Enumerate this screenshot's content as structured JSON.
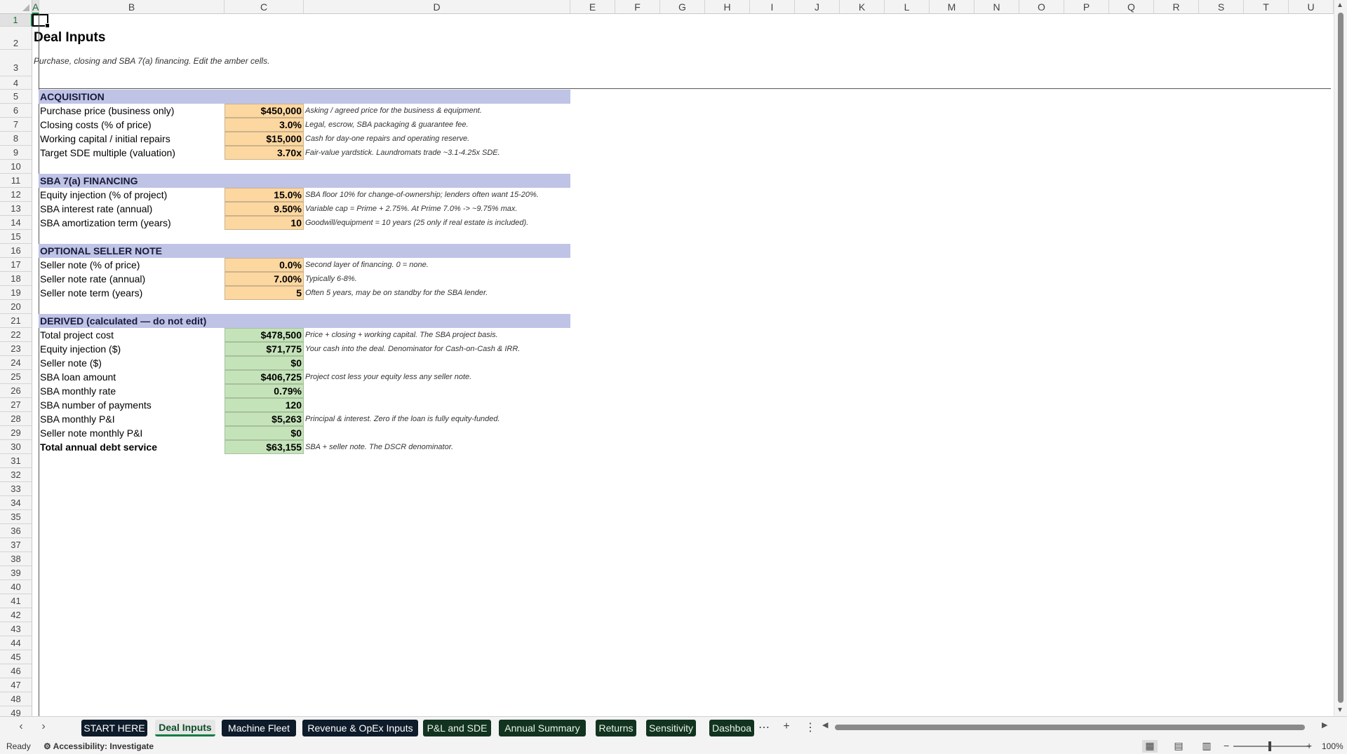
{
  "columns": [
    "A",
    "B",
    "C",
    "D",
    "E",
    "F",
    "G",
    "H",
    "I",
    "J",
    "K",
    "L",
    "M",
    "N",
    "O",
    "P",
    "Q",
    "R",
    "S",
    "T",
    "U"
  ],
  "rows": [
    "1",
    "2",
    "3",
    "4",
    "5",
    "6",
    "7",
    "8",
    "9",
    "10",
    "11",
    "12",
    "13",
    "14",
    "15",
    "16",
    "17",
    "18",
    "19",
    "20",
    "21",
    "22",
    "23",
    "24",
    "25",
    "26",
    "27",
    "28",
    "29",
    "30",
    "31",
    "32",
    "33",
    "34",
    "35",
    "36",
    "37",
    "38",
    "39",
    "40",
    "41",
    "42",
    "43",
    "44",
    "45",
    "46",
    "47",
    "48",
    "49"
  ],
  "sheet": {
    "title": "Deal Inputs",
    "subtitle": "Purchase, closing and SBA 7(a) financing. Edit the amber cells.",
    "acquisition": {
      "header": "ACQUISITION",
      "rows": [
        {
          "label": "Purchase price (business only)",
          "value": "$450,000",
          "note": "Asking / agreed price for the business & equipment."
        },
        {
          "label": "Closing costs (% of price)",
          "value": "3.0%",
          "note": "Legal, escrow, SBA packaging & guarantee fee."
        },
        {
          "label": "Working capital / initial repairs",
          "value": "$15,000",
          "note": "Cash for day-one repairs and operating reserve."
        },
        {
          "label": "Target SDE multiple (valuation)",
          "value": "3.70x",
          "note": "Fair-value yardstick. Laundromats trade ~3.1-4.25x SDE."
        }
      ]
    },
    "financing": {
      "header": "SBA 7(a) FINANCING",
      "rows": [
        {
          "label": "Equity injection (% of project)",
          "value": "15.0%",
          "note": "SBA floor 10% for change-of-ownership; lenders often want 15-20%."
        },
        {
          "label": "SBA interest rate (annual)",
          "value": "9.50%",
          "note": "Variable cap = Prime + 2.75%. At Prime 7.0% -> ~9.75% max."
        },
        {
          "label": "SBA amortization term (years)",
          "value": "10",
          "note": "Goodwill/equipment = 10 years (25 only if real estate is included)."
        }
      ]
    },
    "seller": {
      "header": "OPTIONAL SELLER NOTE",
      "rows": [
        {
          "label": "Seller note (% of price)",
          "value": "0.0%",
          "note": "Second layer of financing. 0 = none."
        },
        {
          "label": "Seller note rate (annual)",
          "value": "7.00%",
          "note": "Typically 6-8%."
        },
        {
          "label": "Seller note term (years)",
          "value": "5",
          "note": "Often 5 years, may be on standby for the SBA lender."
        }
      ]
    },
    "derived": {
      "header": "DERIVED  (calculated — do not edit)",
      "rows": [
        {
          "label": "Total project cost",
          "value": "$478,500",
          "note": "Price + closing + working capital. The SBA project basis."
        },
        {
          "label": "Equity injection ($)",
          "value": "$71,775",
          "note": "Your cash into the deal. Denominator for Cash-on-Cash & IRR."
        },
        {
          "label": "Seller note ($)",
          "value": "$0",
          "note": ""
        },
        {
          "label": "SBA loan amount",
          "value": "$406,725",
          "note": "Project cost less your equity less any seller note."
        },
        {
          "label": "SBA monthly rate",
          "value": "0.79%",
          "note": ""
        },
        {
          "label": "SBA number of payments",
          "value": "120",
          "note": ""
        },
        {
          "label": "SBA monthly P&I",
          "value": "$5,263",
          "note": "Principal & interest. Zero if the loan is fully equity-funded."
        },
        {
          "label": "Seller note monthly P&I",
          "value": "$0",
          "note": ""
        },
        {
          "label": "Total annual debt service",
          "value": "$63,155",
          "note": "SBA + seller note. The DSCR denominator."
        }
      ]
    }
  },
  "tabs": [
    {
      "label": "START HERE",
      "style": "dark"
    },
    {
      "label": "Deal Inputs",
      "style": "active"
    },
    {
      "label": "Machine Fleet",
      "style": "dark"
    },
    {
      "label": "Revenue & OpEx Inputs",
      "style": "dark"
    },
    {
      "label": "P&L and SDE",
      "style": "green"
    },
    {
      "label": "Annual Summary",
      "style": "green"
    },
    {
      "label": "Returns",
      "style": "green"
    },
    {
      "label": "Sensitivity",
      "style": "green"
    },
    {
      "label": "Dashboa",
      "style": "green"
    }
  ],
  "tab_icons": {
    "more": "⋯",
    "add": "+",
    "options": "⋮",
    "prev": "‹",
    "next": "›"
  },
  "status": {
    "ready": "Ready",
    "accessibility": "Accessibility: Investigate",
    "zoom": "100%"
  },
  "colors": {
    "input_fill": "#fdd7a0",
    "derived_fill": "#c5e3b9",
    "section_fill": "#bfc3e6",
    "tab_dark": "#0d1b2a",
    "tab_green": "#12331f",
    "excel_green": "#107c41"
  }
}
